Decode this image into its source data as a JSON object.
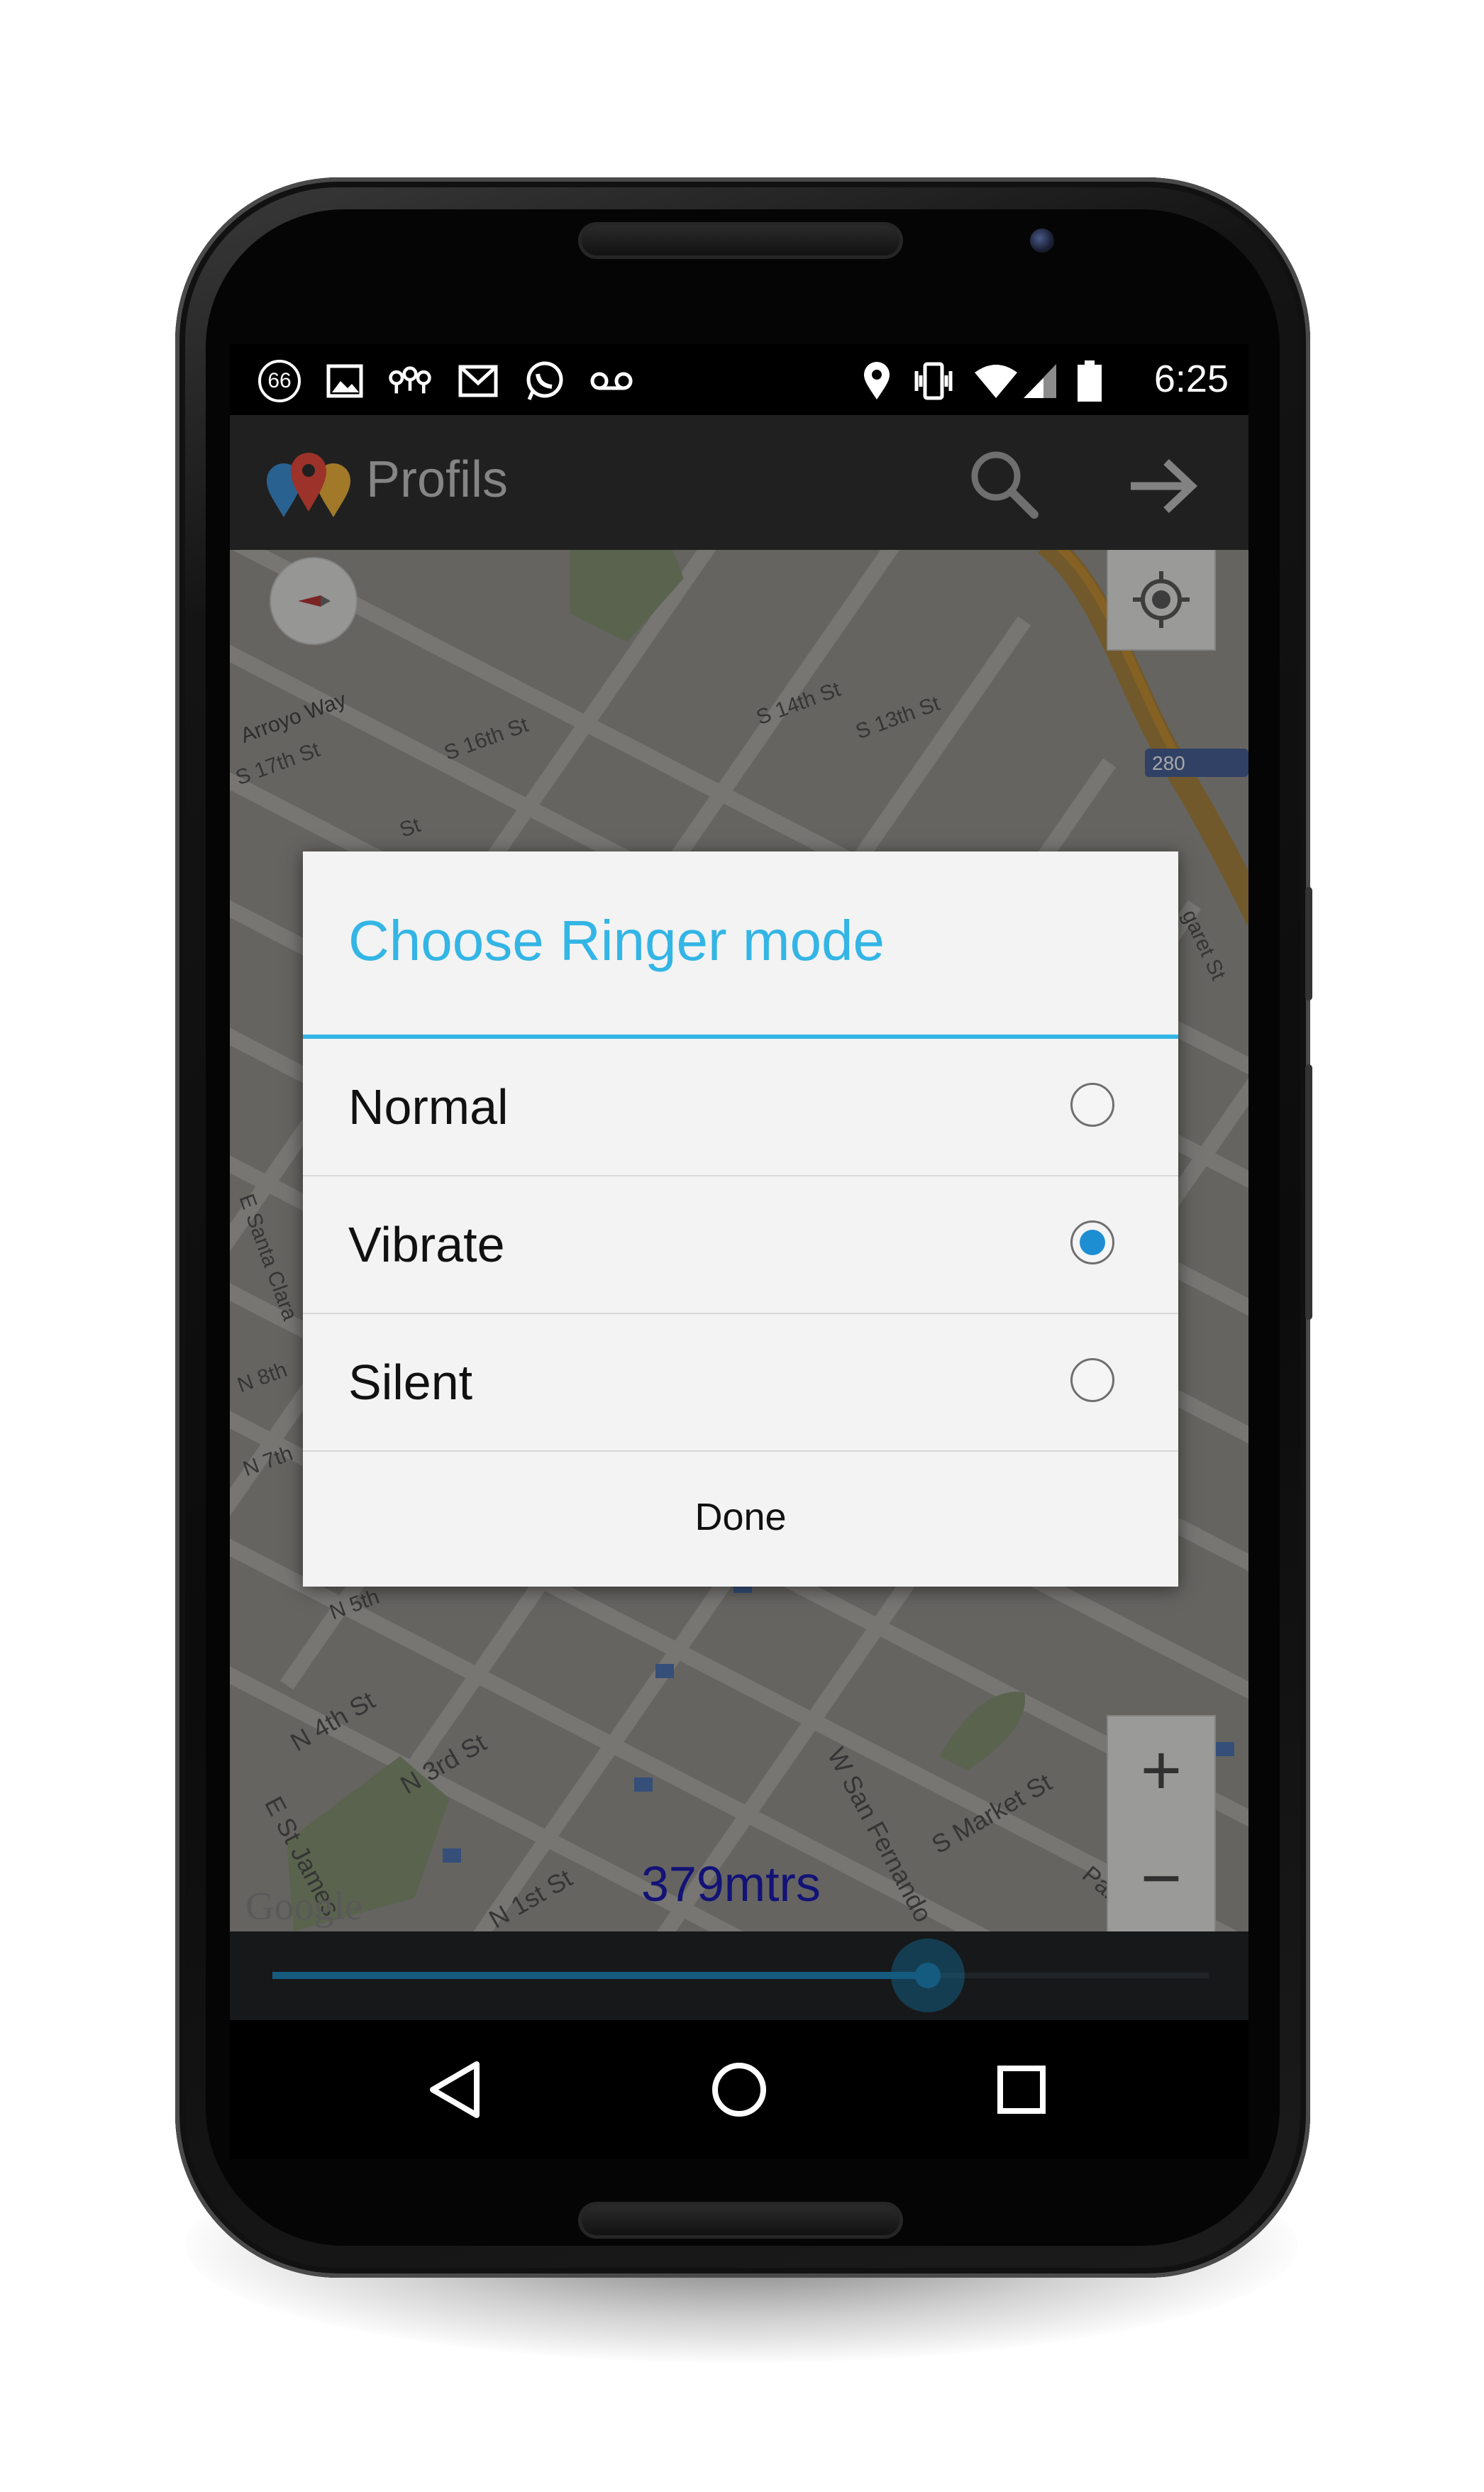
{
  "status_bar": {
    "time": "6:25",
    "notification_badge": "66",
    "left_icons": [
      "gallery-icon",
      "map-pins-icon",
      "gmail-icon",
      "whatsapp-icon",
      "voicemail-icon"
    ],
    "right_icons": [
      "location-icon",
      "vibrate-icon",
      "wifi-icon",
      "cell-signal-icon",
      "battery-icon"
    ]
  },
  "app_bar": {
    "title": "Profils",
    "actions": [
      "search-icon",
      "arrow-right-icon"
    ]
  },
  "map": {
    "streets": [
      "Arroyo Way",
      "S 17th St",
      "S 16th St",
      "S 14th St",
      "S 13th St",
      "St",
      "E Santa Clara",
      "N 8th",
      "N 7th",
      "N 5th",
      "N 4th St",
      "N 3rd St",
      "E St James",
      "N 1st St",
      "W San Fernando",
      "S Market St",
      "garet St",
      "Par",
      "280",
      "Google"
    ],
    "zoom_in": "+",
    "zoom_out": "−",
    "radius_label": "379mtrs",
    "radius_fraction": 0.7
  },
  "dialog": {
    "title": "Choose Ringer mode",
    "options": [
      {
        "label": "Normal",
        "selected": false
      },
      {
        "label": "Vibrate",
        "selected": true
      },
      {
        "label": "Silent",
        "selected": false
      }
    ],
    "done_label": "Done"
  },
  "colors": {
    "accent": "#33b5e5",
    "radio_selected": "#1e8ed3",
    "slider": "#1e7fb0",
    "radius_text": "#1a1aa6"
  }
}
